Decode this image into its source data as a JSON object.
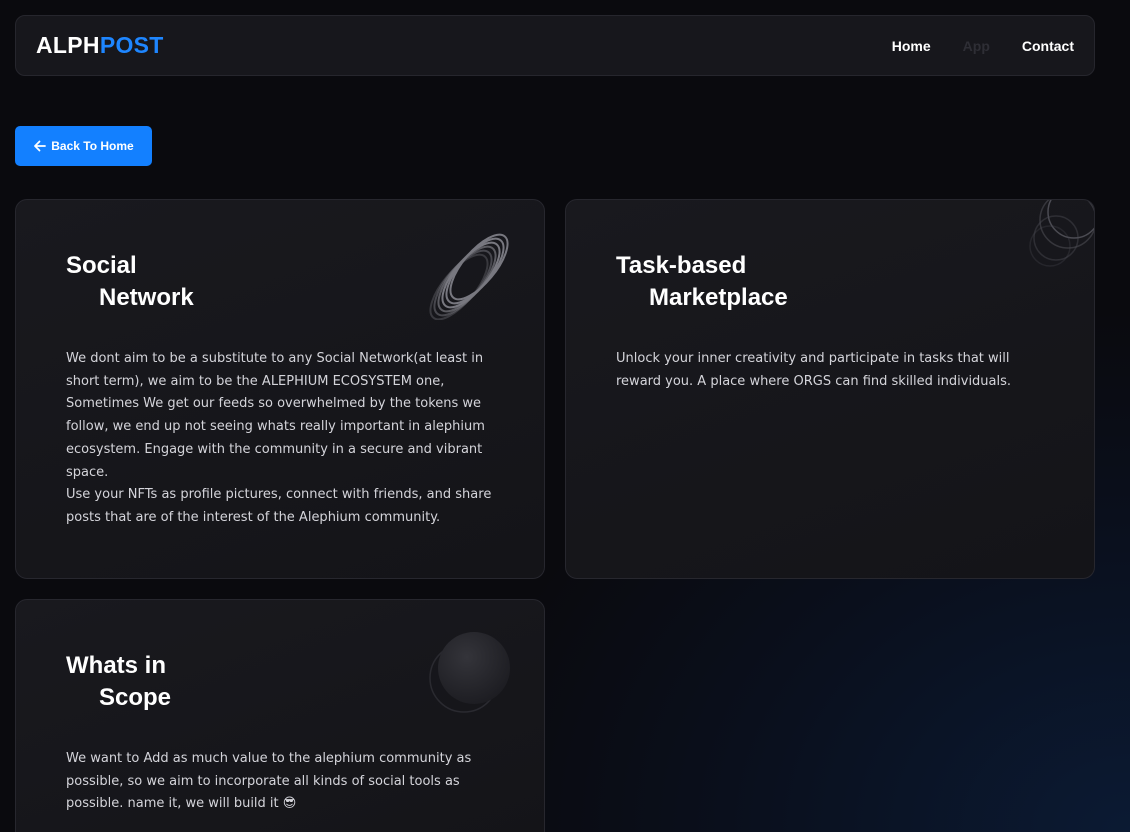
{
  "header": {
    "logo_part1": "ALPH",
    "logo_part2": "POST",
    "nav": [
      {
        "label": "Home"
      },
      {
        "label": "App"
      },
      {
        "label": "Contact"
      }
    ]
  },
  "back_button": {
    "label": "Back To Home",
    "icon": "arrow-left-icon"
  },
  "cards": [
    {
      "title_line1": "Social",
      "title_line2": "Network",
      "body": "We dont aim to be a substitute to any Social Network(at least in short term), we aim to be the ALEPHIUM ECOSYSTEM one, Sometimes We get our feeds so overwhelmed by the tokens we follow, we end up not seeing whats really important in alephium ecosystem. Engage with the community in a secure and vibrant space.\nUse your NFTs as profile pictures, connect with friends, and share posts that are of the interest of the Alephium community.",
      "icon": "wire-coil-icon"
    },
    {
      "title_line1": "Task-based",
      "title_line2": "Marketplace",
      "body": "Unlock your inner creativity and participate in tasks that will reward you. A place where ORGS can find skilled individuals.",
      "icon": "rings-icon"
    },
    {
      "title_line1": "Whats in",
      "title_line2": "Scope",
      "body": "We want to Add as much value to the alephium community as possible, so we aim to incorporate all kinds of social tools as possible. name it, we will build it 😎",
      "icon": "sphere-icon"
    }
  ],
  "colors": {
    "accent": "#1380ff",
    "logo_blue": "#1e86ff",
    "card_bg": "#17171c",
    "page_bg": "#0a0a0e"
  }
}
